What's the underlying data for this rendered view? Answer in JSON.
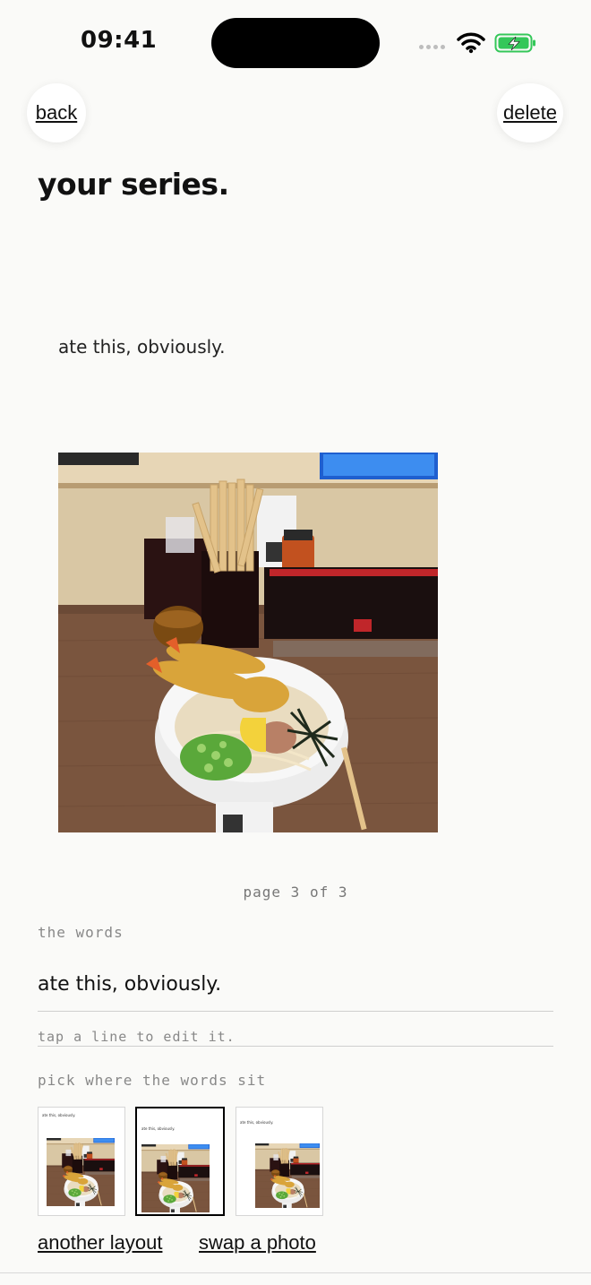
{
  "status_bar": {
    "time": "09:41"
  },
  "nav": {
    "back_label": "back",
    "delete_label": "delete"
  },
  "title": "your series.",
  "preview": {
    "caption": "ate this, obviously.",
    "photo_icon": "udon-tempura-photo"
  },
  "pagination": {
    "label": "page 3 of 3",
    "current": 3,
    "total": 3
  },
  "words": {
    "label": "the words",
    "line": "ate this, obviously.",
    "hint": "tap a line to edit it."
  },
  "layout_picker": {
    "label": "pick where the words sit",
    "options": [
      {
        "caption": "ate this, obviously.",
        "selected": false
      },
      {
        "caption": "ate this, obviously.",
        "selected": true
      },
      {
        "caption": "ate this, obviously.",
        "selected": false
      }
    ]
  },
  "actions": {
    "another_layout": "another layout",
    "swap_photo": "swap a photo"
  },
  "colors": {
    "background": "#fafaf8",
    "battery_green": "#34c759",
    "text": "#111111"
  }
}
